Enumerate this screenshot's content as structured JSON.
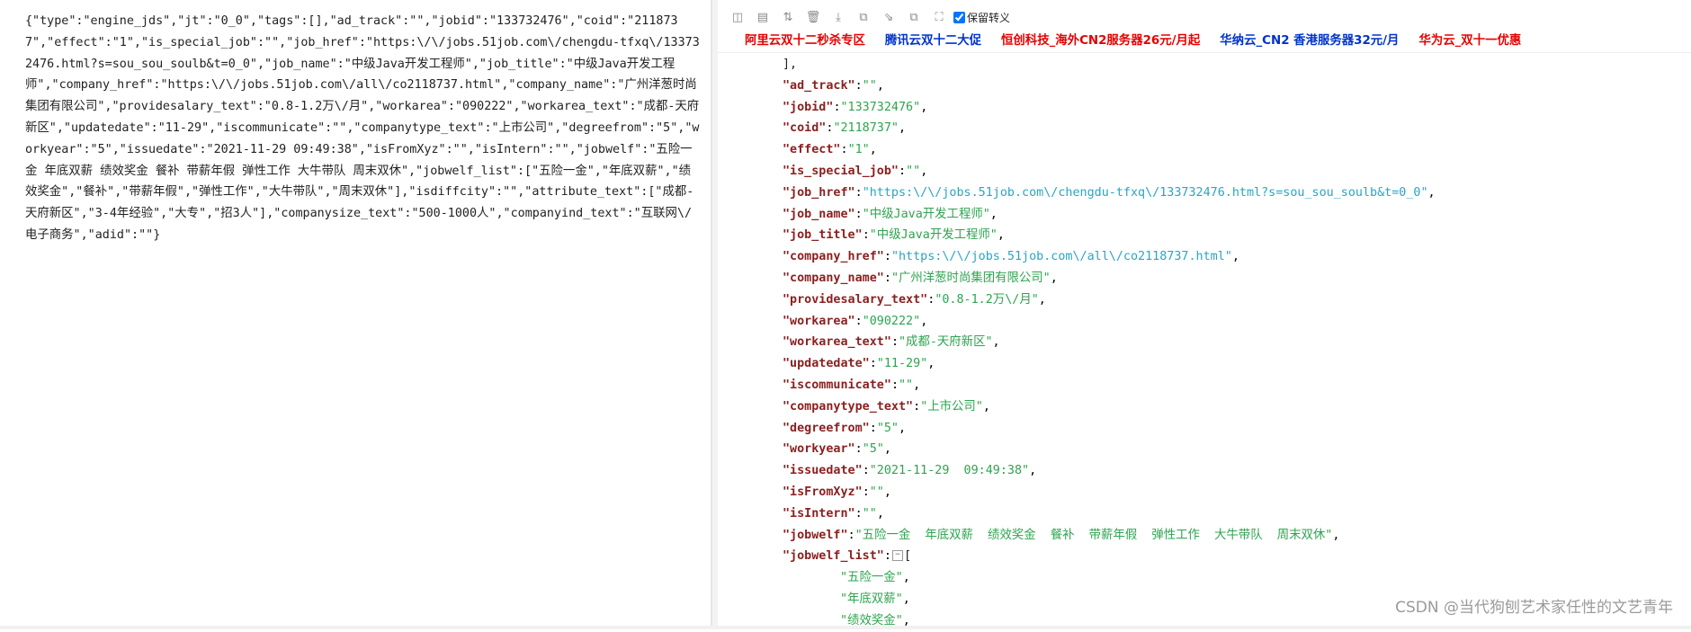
{
  "left": {
    "raw_json": "{\"type\":\"engine_jds\",\"jt\":\"0_0\",\"tags\":[],\"ad_track\":\"\",\"jobid\":\"133732476\",\"coid\":\"2118737\",\"effect\":\"1\",\"is_special_job\":\"\",\"job_href\":\"https:\\/\\/jobs.51job.com\\/chengdu-tfxq\\/133732476.html?s=sou_sou_soulb&t=0_0\",\"job_name\":\"中级Java开发工程师\",\"job_title\":\"中级Java开发工程师\",\"company_href\":\"https:\\/\\/jobs.51job.com\\/all\\/co2118737.html\",\"company_name\":\"广州洋葱时尚集团有限公司\",\"providesalary_text\":\"0.8-1.2万\\/月\",\"workarea\":\"090222\",\"workarea_text\":\"成都-天府新区\",\"updatedate\":\"11-29\",\"iscommunicate\":\"\",\"companytype_text\":\"上市公司\",\"degreefrom\":\"5\",\"workyear\":\"5\",\"issuedate\":\"2021-11-29 09:49:38\",\"isFromXyz\":\"\",\"isIntern\":\"\",\"jobwelf\":\"五险一金 年底双薪 绩效奖金 餐补 带薪年假 弹性工作 大牛带队 周末双休\",\"jobwelf_list\":[\"五险一金\",\"年底双薪\",\"绩效奖金\",\"餐补\",\"带薪年假\",\"弹性工作\",\"大牛带队\",\"周末双休\"],\"isdiffcity\":\"\",\"attribute_text\":[\"成都-天府新区\",\"3-4年经验\",\"大专\",\"招3人\"],\"companysize_text\":\"500-1000人\",\"companyind_text\":\"互联网\\/电子商务\",\"adid\":\"\"}"
  },
  "toolbar": {
    "icons": [
      "database-icon",
      "excel-icon",
      "sort-icon",
      "trash-icon",
      "download-icon",
      "copy-icon",
      "compress-icon",
      "expand-icon",
      "fullscreen-icon"
    ],
    "checkbox_label": "保留转义",
    "checkbox_checked": true
  },
  "ads": [
    {
      "label": "阿里云双十二秒杀专区",
      "color": "red"
    },
    {
      "label": "腾讯云双十二大促",
      "color": "blue"
    },
    {
      "label": "恒创科技_海外CN2服务器26元/月起",
      "color": "red"
    },
    {
      "label": "华纳云_CN2 香港服务器32元/月",
      "color": "blue"
    },
    {
      "label": "华为云_双十一优惠",
      "color": "red"
    }
  ],
  "formatted": {
    "lines": [
      {
        "indent": 1,
        "punct": "],"
      },
      {
        "indent": 1,
        "key": "\"ad_track\"",
        "value": "\"\"",
        "type": "str"
      },
      {
        "indent": 1,
        "key": "\"jobid\"",
        "value": "\"133732476\"",
        "type": "str"
      },
      {
        "indent": 1,
        "key": "\"coid\"",
        "value": "\"2118737\"",
        "type": "str"
      },
      {
        "indent": 1,
        "key": "\"effect\"",
        "value": "\"1\"",
        "type": "str"
      },
      {
        "indent": 1,
        "key": "\"is_special_job\"",
        "value": "\"\"",
        "type": "str"
      },
      {
        "indent": 1,
        "key": "\"job_href\"",
        "value": "\"https:\\/\\/jobs.51job.com\\/chengdu-tfxq\\/133732476.html?s=sou_sou_soulb&t=0_0\"",
        "type": "url"
      },
      {
        "indent": 1,
        "key": "\"job_name\"",
        "value": "\"中级Java开发工程师\"",
        "type": "str"
      },
      {
        "indent": 1,
        "key": "\"job_title\"",
        "value": "\"中级Java开发工程师\"",
        "type": "str"
      },
      {
        "indent": 1,
        "key": "\"company_href\"",
        "value": "\"https:\\/\\/jobs.51job.com\\/all\\/co2118737.html\"",
        "type": "url"
      },
      {
        "indent": 1,
        "key": "\"company_name\"",
        "value": "\"广州洋葱时尚集团有限公司\"",
        "type": "str"
      },
      {
        "indent": 1,
        "key": "\"providesalary_text\"",
        "value": "\"0.8-1.2万\\/月\"",
        "type": "str"
      },
      {
        "indent": 1,
        "key": "\"workarea\"",
        "value": "\"090222\"",
        "type": "str"
      },
      {
        "indent": 1,
        "key": "\"workarea_text\"",
        "value": "\"成都-天府新区\"",
        "type": "str"
      },
      {
        "indent": 1,
        "key": "\"updatedate\"",
        "value": "\"11-29\"",
        "type": "str"
      },
      {
        "indent": 1,
        "key": "\"iscommunicate\"",
        "value": "\"\"",
        "type": "str"
      },
      {
        "indent": 1,
        "key": "\"companytype_text\"",
        "value": "\"上市公司\"",
        "type": "str"
      },
      {
        "indent": 1,
        "key": "\"degreefrom\"",
        "value": "\"5\"",
        "type": "str"
      },
      {
        "indent": 1,
        "key": "\"workyear\"",
        "value": "\"5\"",
        "type": "str"
      },
      {
        "indent": 1,
        "key": "\"issuedate\"",
        "value": "\"2021-11-29  09:49:38\"",
        "type": "str"
      },
      {
        "indent": 1,
        "key": "\"isFromXyz\"",
        "value": "\"\"",
        "type": "str"
      },
      {
        "indent": 1,
        "key": "\"isIntern\"",
        "value": "\"\"",
        "type": "str"
      },
      {
        "indent": 1,
        "key": "\"jobwelf\"",
        "value": "\"五险一金  年底双薪  绩效奖金  餐补  带薪年假  弹性工作  大牛带队  周末双休\"",
        "type": "str"
      },
      {
        "indent": 1,
        "key": "\"jobwelf_list\"",
        "open": "[",
        "type": "open"
      },
      {
        "indent": 2,
        "value": "\"五险一金\"",
        "type": "item"
      },
      {
        "indent": 2,
        "value": "\"年底双薪\"",
        "type": "item"
      },
      {
        "indent": 2,
        "value": "\"绩效奖金\"",
        "type": "item"
      }
    ]
  },
  "watermark": "CSDN @当代狗刨艺术家任性的文艺青年"
}
